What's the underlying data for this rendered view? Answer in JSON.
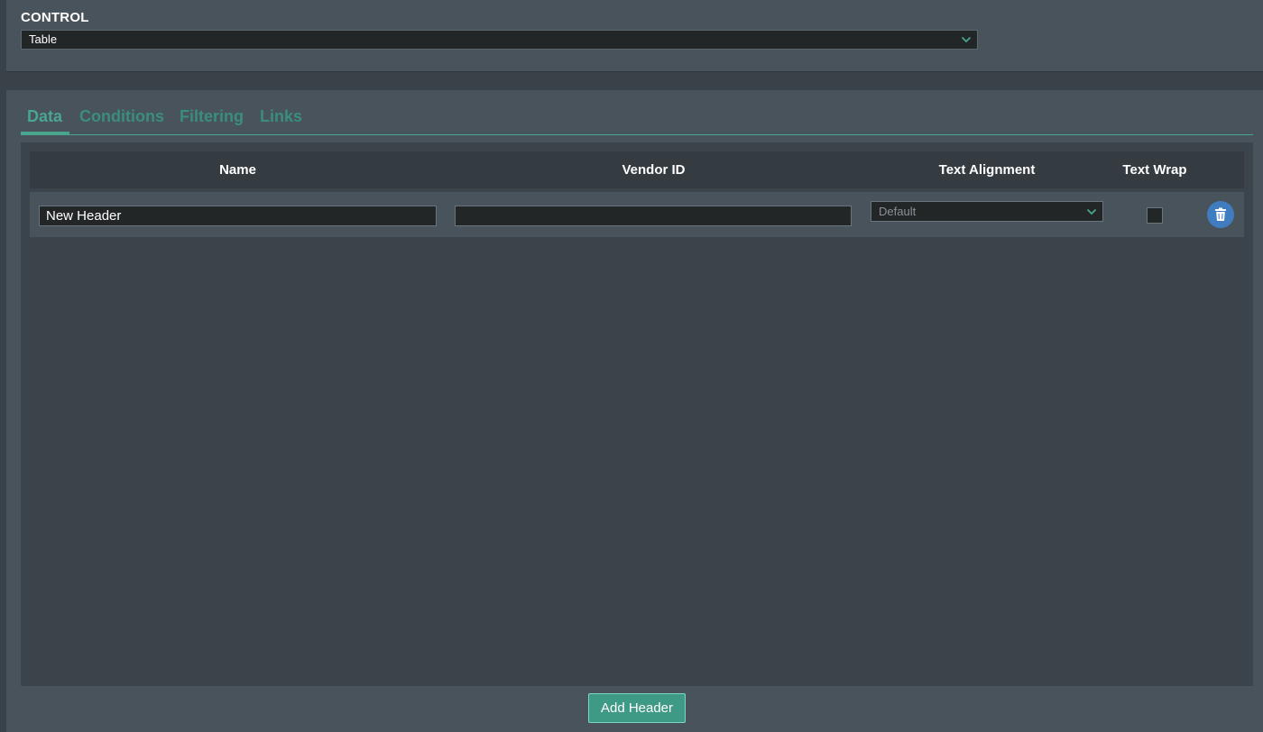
{
  "control": {
    "label": "CONTROL",
    "selected_value": "Table"
  },
  "tabs": [
    {
      "label": "Data",
      "active": true
    },
    {
      "label": "Conditions",
      "active": false
    },
    {
      "label": "Filtering",
      "active": false
    },
    {
      "label": "Links",
      "active": false
    }
  ],
  "grid": {
    "columns": [
      "Name",
      "Vendor ID",
      "Text Alignment",
      "Text Wrap"
    ],
    "rows": [
      {
        "name": "New Header",
        "vendor_id": "",
        "text_alignment": "Default",
        "text_wrap": false
      }
    ]
  },
  "actions": {
    "add_header_label": "Add Header"
  },
  "icons": {
    "select_chevron": "chevron-down-icon",
    "delete": "trash-icon"
  },
  "colors": {
    "accent": "#4aa58f",
    "delete_button": "#3f7dc0",
    "panel": "#48535c",
    "background": "#3a4249"
  }
}
